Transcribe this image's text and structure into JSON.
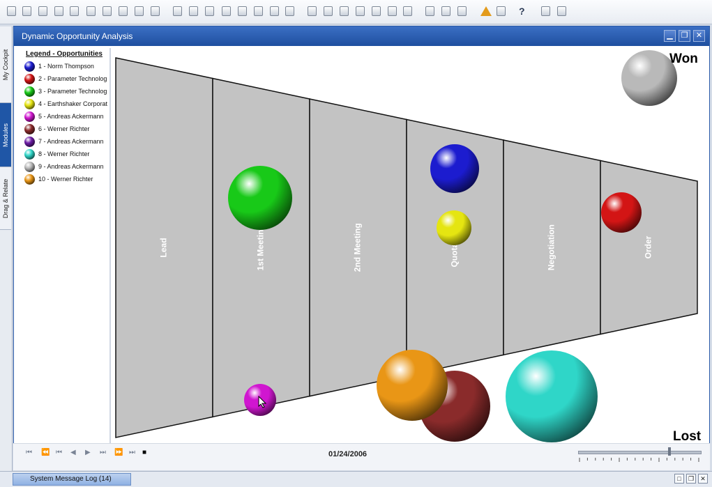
{
  "toolbar": {
    "icons": [
      "new-document-icon",
      "print-icon",
      "print-preview-icon",
      "document-icon",
      "fax-icon",
      "email-icon",
      "word-export-icon",
      "excel-export-icon",
      "navigate-icon",
      "lock-icon",
      "first-record-icon",
      "previous-record-icon",
      "next-record-icon",
      "last-record-icon",
      "find-icon",
      "record-icon",
      "filter-icon",
      "sort-icon",
      "copy-icon",
      "paste-icon",
      "duplicate-icon",
      "link-icon",
      "base-document-icon",
      "target-document-icon",
      "settings-icon",
      "edit-icon",
      "document-edit-icon",
      "preview-icon",
      "alert-icon",
      "calendar-icon",
      "help-icon",
      "configure-icon",
      "export-icon"
    ]
  },
  "side_tabs": [
    {
      "label": "My Cockpit",
      "active": false
    },
    {
      "label": "Modules",
      "active": true
    },
    {
      "label": "Drag & Relate",
      "active": false
    }
  ],
  "window": {
    "title": "Dynamic Opportunity Analysis",
    "buttons": [
      "minimize",
      "restore",
      "close"
    ]
  },
  "legend": {
    "title": "Legend - Opportunities",
    "items": [
      {
        "label": "1 - Norm Thompson",
        "color": "#1c1ccf"
      },
      {
        "label": "2 - Parameter Technolog",
        "color": "#d31515"
      },
      {
        "label": "3 - Parameter Technolog",
        "color": "#18c918"
      },
      {
        "label": "4 - Earthshaker Corporat",
        "color": "#e5e511"
      },
      {
        "label": "5 - Andreas Ackermann",
        "color": "#d016d0"
      },
      {
        "label": "6 - Werner Richter",
        "color": "#8a2b2b"
      },
      {
        "label": "7 - Andreas Ackermann",
        "color": "#6c1ca5"
      },
      {
        "label": "8 - Werner Richter",
        "color": "#2fd6c8"
      },
      {
        "label": "9 - Andreas Ackermann",
        "color": "#b9b9b9"
      },
      {
        "label": "10 - Werner Richter",
        "color": "#e99616"
      }
    ]
  },
  "stages": [
    "Lead",
    "1st Meeting",
    "2nd Meeting",
    "Quotation",
    "Negotiation",
    "Order"
  ],
  "annotations": {
    "won": "Won",
    "lost": "Lost"
  },
  "playback": {
    "buttons": [
      "first",
      "rewind",
      "step-back-start",
      "back",
      "play",
      "step-forward-end",
      "forward",
      "last",
      "stop"
    ],
    "date": "01/24/2006",
    "slider_value": 0.75
  },
  "status": {
    "message_log": "System Message Log (14)"
  }
}
